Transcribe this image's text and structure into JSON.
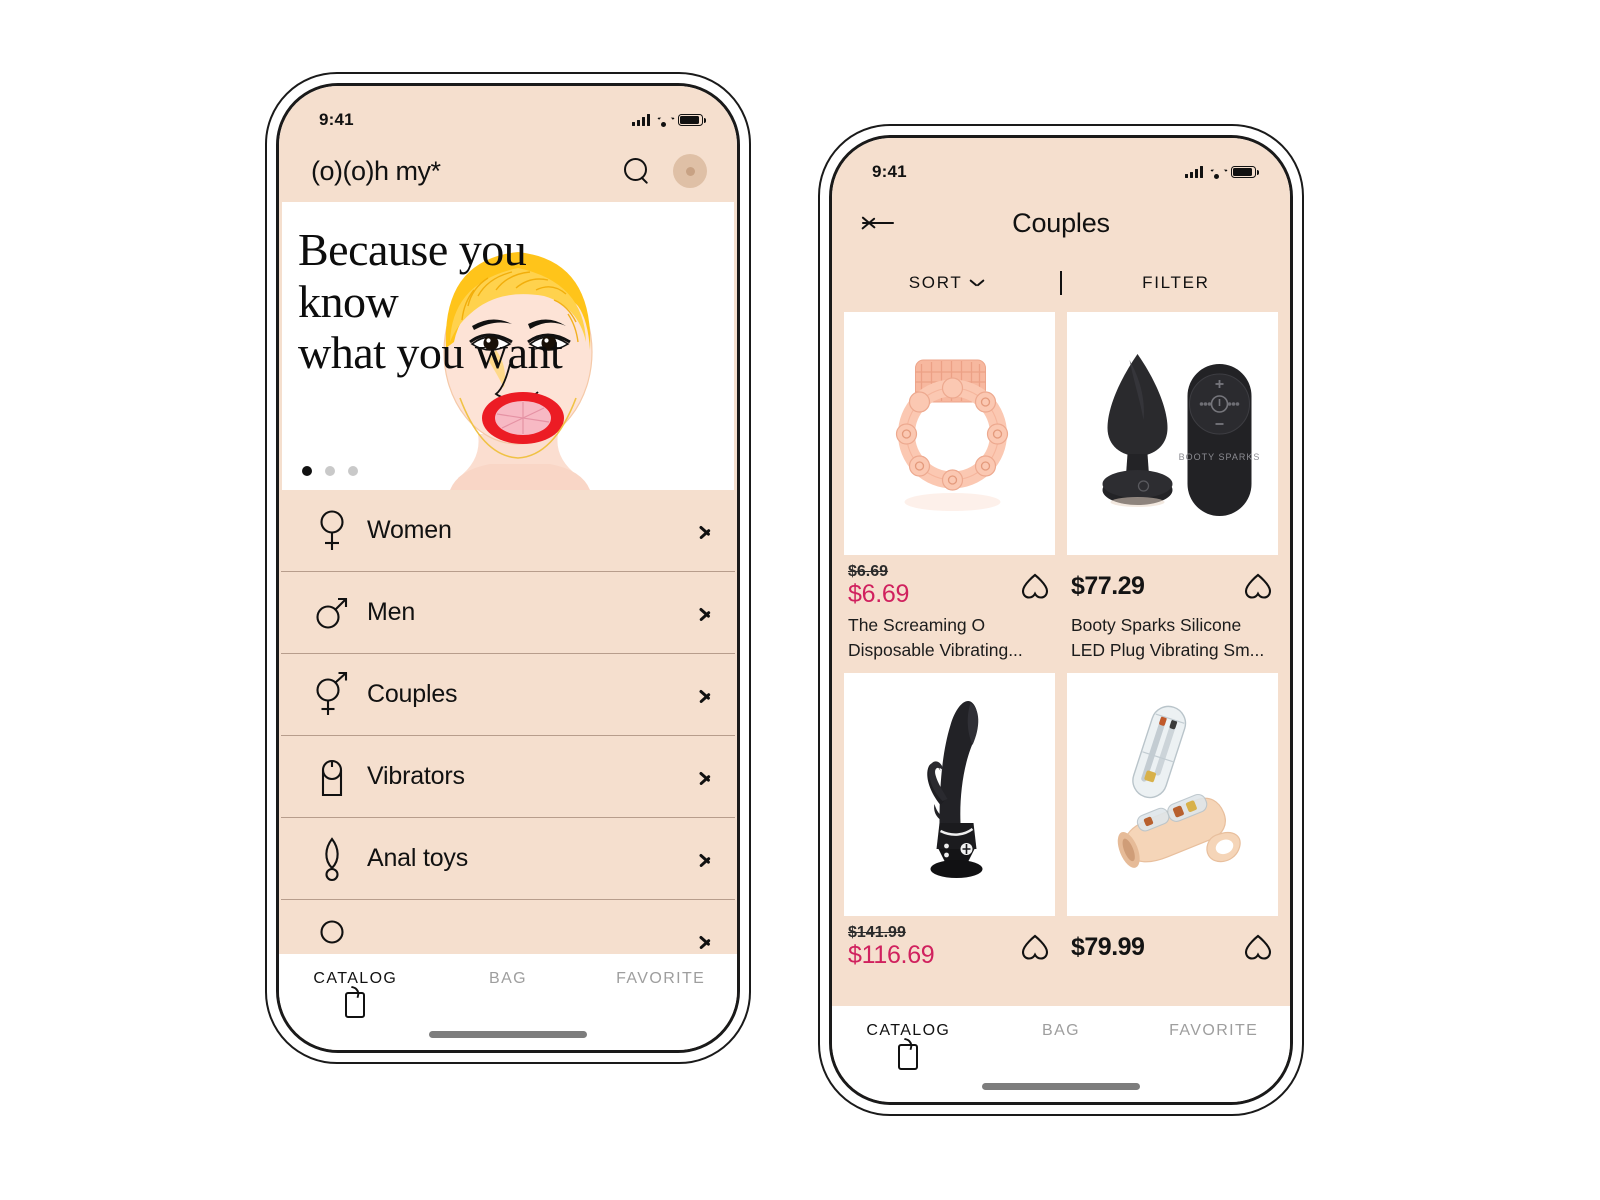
{
  "theme": {
    "bg_cream": "#f5dfce",
    "accent_pink": "#d0215e",
    "text_dark": "#111111",
    "muted": "#9e9e9e",
    "card_white": "#ffffff",
    "divider": "#b79d8c"
  },
  "phone1": {
    "status": {
      "time": "9:41",
      "signal_icon": "cellular-signal-icon",
      "wifi_icon": "wifi-icon",
      "battery_icon": "battery-icon"
    },
    "header": {
      "brand": "(o)(o)h my*",
      "search_icon": "search-icon",
      "avatar_icon": "avatar"
    },
    "hero": {
      "line1": "Because you",
      "line2": "know",
      "line3": "what you want",
      "dots_total": 3,
      "active_dot": 0
    },
    "categories": [
      {
        "label": "Women",
        "icon": "venus-icon"
      },
      {
        "label": "Men",
        "icon": "mars-icon"
      },
      {
        "label": "Couples",
        "icon": "venus-mars-icon"
      },
      {
        "label": "Vibrators",
        "icon": "vibrator-icon"
      },
      {
        "label": "Anal toys",
        "icon": "plug-icon"
      },
      {
        "label": "",
        "icon": "partial-icon"
      }
    ],
    "tabs": [
      {
        "label": "CATALOG",
        "icon": "tag-icon",
        "active": true
      },
      {
        "label": "BAG",
        "icon": "",
        "active": false
      },
      {
        "label": "FAVORITE",
        "icon": "",
        "active": false
      }
    ]
  },
  "phone2": {
    "status": {
      "time": "9:41",
      "signal_icon": "cellular-signal-icon",
      "wifi_icon": "wifi-icon",
      "battery_icon": "battery-icon"
    },
    "nav": {
      "back_icon": "back-arrow-icon",
      "title": "Couples"
    },
    "toolbar": {
      "sort_label": "SORT",
      "sort_caret_icon": "chevron-down-icon",
      "filter_label": "FILTER"
    },
    "products": [
      {
        "image": "cock-ring-beaded",
        "old_price": "$6.69",
        "price": "$6.69",
        "on_sale": true,
        "title": "The Screaming O Disposable Vibrating...",
        "favorite_icon": "heart-icon"
      },
      {
        "image": "black-plug-with-remote",
        "old_price": "",
        "price": "$77.29",
        "on_sale": false,
        "title": "Booty Sparks Silicone LED Plug Vibrating Sm...",
        "favorite_icon": "heart-icon"
      },
      {
        "image": "black-rabbit-vibrator",
        "old_price": "$141.99",
        "price": "$116.69",
        "on_sale": true,
        "title": "",
        "favorite_icon": "heart-icon"
      },
      {
        "image": "flesh-sleeve-with-bullet",
        "old_price": "",
        "price": "$79.99",
        "on_sale": false,
        "title": "",
        "favorite_icon": "heart-icon"
      }
    ],
    "tabs": [
      {
        "label": "CATALOG",
        "icon": "tag-icon",
        "active": true
      },
      {
        "label": "BAG",
        "icon": "",
        "active": false
      },
      {
        "label": "FAVORITE",
        "icon": "",
        "active": false
      }
    ]
  }
}
